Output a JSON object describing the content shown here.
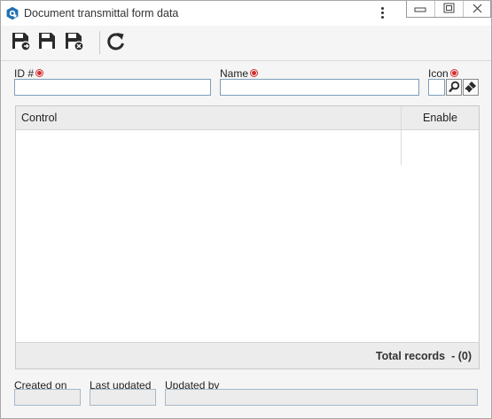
{
  "window": {
    "title": "Document transmittal form data",
    "controls": [
      "minimize-icon",
      "restore-icon",
      "close-icon"
    ],
    "menu_icon": "kebab-menu-icon"
  },
  "toolbar": {
    "buttons": [
      {
        "icon": "save-and-new-icon"
      },
      {
        "icon": "save-icon"
      },
      {
        "icon": "save-and-close-icon"
      },
      {
        "icon": "refresh-icon"
      }
    ]
  },
  "form": {
    "id_label": "ID #",
    "id_value": "",
    "name_label": "Name",
    "name_value": "",
    "icon_label": "Icon",
    "icon_buttons": [
      "search-icon",
      "clear-brush-icon"
    ]
  },
  "grid": {
    "columns": [
      "Control",
      "Enable"
    ],
    "rows": [],
    "total_label": "Total records",
    "total_value": "- (0)"
  },
  "audit": {
    "created_on_label": "Created on",
    "created_on_value": "",
    "last_updated_label": "Last updated",
    "last_updated_value": "",
    "updated_by_label": "Updated by",
    "updated_by_value": ""
  },
  "colors": {
    "required": "#d32f2f",
    "input_border": "#7f9db9",
    "icon_dark": "#2b2b2b",
    "app_icon": "#1e6fb5"
  }
}
